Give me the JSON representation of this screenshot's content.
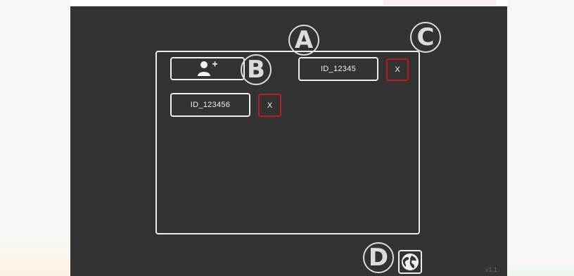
{
  "users": {
    "add_button_icon": "add-user-icon",
    "items": [
      {
        "id": "ID_12345",
        "delete_label": "X"
      },
      {
        "id": "ID_123456",
        "delete_label": "X"
      }
    ]
  },
  "annotations": {
    "a": "A",
    "b": "B",
    "c": "C",
    "d": "D"
  },
  "language_button_icon": "globe-icon",
  "version": "v1.1",
  "colors": {
    "screen_bg": "#333333",
    "border": "#eeeeee",
    "delete_border": "#b21f24"
  }
}
